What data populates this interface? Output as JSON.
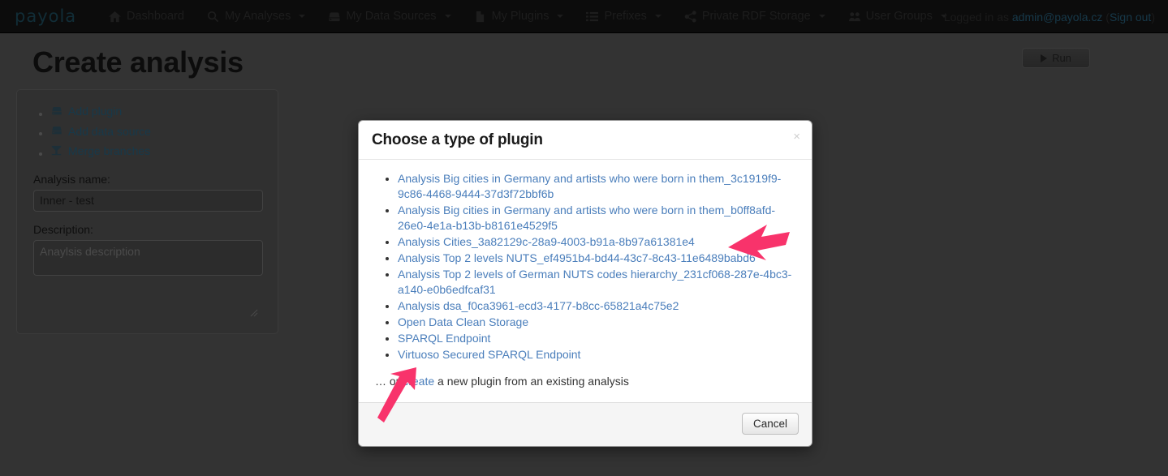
{
  "navbar": {
    "brand": "payola",
    "items": [
      {
        "label": "Dashboard",
        "icon": "home-icon",
        "caret": false
      },
      {
        "label": "My Analyses",
        "icon": "search-icon",
        "caret": true
      },
      {
        "label": "My Data Sources",
        "icon": "hdd-icon",
        "caret": true
      },
      {
        "label": "My Plugins",
        "icon": "file-icon",
        "caret": true
      },
      {
        "label": "Prefixes",
        "icon": "list-icon",
        "caret": true
      },
      {
        "label": "Private RDF Storage",
        "icon": "share-icon",
        "caret": true
      },
      {
        "label": "User Groups",
        "icon": "users-icon",
        "caret": true
      }
    ],
    "logged_in_prefix": "Logged in as",
    "user_email": "admin@payola.cz",
    "sign_out_open": "(",
    "sign_out": "Sign out",
    "sign_out_close": ")"
  },
  "page": {
    "title": "Create analysis",
    "run_label": "Run",
    "run_icon": "play-icon"
  },
  "panel": {
    "actions": [
      {
        "label": "Add plugin",
        "icon": "hdd-icon"
      },
      {
        "label": "Add data source",
        "icon": "hdd-icon"
      },
      {
        "label": "Merge branches",
        "icon": "funnel-icon"
      }
    ],
    "name_label": "Analysis name:",
    "name_value": "Inner - test",
    "description_label": "Description:",
    "description_value": "",
    "description_placeholder": "Anaylsis description"
  },
  "modal": {
    "title": "Choose a type of plugin",
    "close_icon": "close-icon",
    "close_label": "×",
    "plugins": [
      "Analysis Big cities in Germany and artists who were born in them_3c1919f9-9c86-4468-9444-37d3f72bbf6b",
      "Analysis Big cities in Germany and artists who were born in them_b0ff8afd-26e0-4e1a-b13b-b8161e4529f5",
      "Analysis Cities_3a82129c-28a9-4003-b91a-8b97a61381e4",
      "Analysis Top 2 levels NUTS_ef4951b4-bd44-43c7-8c43-11e6489babd6",
      "Analysis Top 2 levels of German NUTS codes hierarchy_231cf068-287e-4bc3-a140-e0b6edfcaf31",
      "Analysis dsa_f0ca3961-ecd3-4177-b8cc-65821a4c75e2",
      "Open Data Clean Storage",
      "SPARQL Endpoint",
      "Virtuoso Secured SPARQL Endpoint"
    ],
    "footer_text_before": "… or ",
    "footer_link": "create",
    "footer_text_after": " a new plugin from an existing analysis",
    "cancel_label": "Cancel"
  },
  "annotations": {
    "arrow_color": "#f8336b",
    "arrows": [
      {
        "name": "arrow-pointing-to-plugin-nuts",
        "target": "Analysis Top 2 levels NUTS_ef4951b4-bd44-43c7-8c43-11e6489babd6"
      },
      {
        "name": "arrow-pointing-to-create-link",
        "target": "create"
      }
    ]
  },
  "colors": {
    "background": "#333333",
    "navbar": "#0c0c0c",
    "link": "#4a7ebb",
    "accent_pink": "#f8336b",
    "modal_bg": "#ffffff"
  }
}
